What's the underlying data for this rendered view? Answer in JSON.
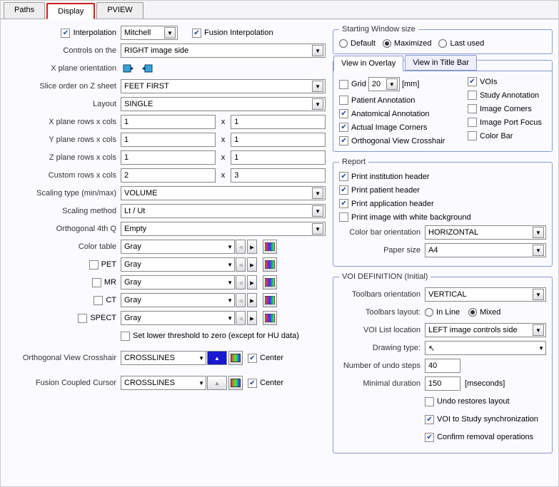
{
  "tabs": {
    "paths": "Paths",
    "display": "Display",
    "pview": "PVIEW"
  },
  "interp": {
    "label": "Interpolation",
    "value": "Mitchell",
    "fusion": "Fusion Interpolation"
  },
  "controlsOn": {
    "label": "Controls on the",
    "value": "RIGHT image side"
  },
  "xplane": {
    "label": "X plane orientation"
  },
  "sliceOrder": {
    "label": "Slice order on Z sheet",
    "value": "FEET FIRST"
  },
  "layout": {
    "label": "Layout",
    "value": "SINGLE"
  },
  "rowscols": {
    "x": {
      "label": "X plane rows x cols",
      "r": "1",
      "c": "1"
    },
    "y": {
      "label": "Y plane rows x cols",
      "r": "1",
      "c": "1"
    },
    "z": {
      "label": "Z plane rows x cols",
      "r": "1",
      "c": "1"
    },
    "custom": {
      "label": "Custom rows x cols",
      "r": "2",
      "c": "3"
    },
    "sep": "x"
  },
  "scalingType": {
    "label": "Scaling type (min/max)",
    "value": "VOLUME"
  },
  "scalingMethod": {
    "label": "Scaling method",
    "value": "Lt / Ut"
  },
  "ortho4q": {
    "label": "Orthogonal 4th Q",
    "value": "Empty"
  },
  "colorTable": {
    "label": "Color table",
    "value": "Gray"
  },
  "pet": {
    "label": "PET",
    "value": "Gray"
  },
  "mr": {
    "label": "MR",
    "value": "Gray"
  },
  "ct": {
    "label": "CT",
    "value": "Gray"
  },
  "spect": {
    "label": "SPECT",
    "value": "Gray"
  },
  "lowerThresh": "Set lower threshold to zero (except for HU data)",
  "orthoCrosshair": {
    "label": "Orthogonal View Crosshair",
    "value": "CROSSLINES",
    "center": "Center"
  },
  "fusionCursor": {
    "label": "Fusion Coupled Cursor",
    "value": "CROSSLINES",
    "center": "Center"
  },
  "startWin": {
    "legend": "Starting Window size",
    "default": "Default",
    "maximized": "Maximized",
    "lastused": "Last used"
  },
  "viewTabs": {
    "overlay": "View in Overlay",
    "titlebar": "View in Title Bar"
  },
  "overlay": {
    "grid": "Grid",
    "gridVal": "20",
    "gridUnit": "[mm]",
    "vois": "VOIs",
    "patAnn": "Patient Annotation",
    "studyAnn": "Study Annotation",
    "anatAnn": "Anatomical Annotation",
    "imgCorners": "Image Corners",
    "actCorners": "Actual Image Corners",
    "portFocus": "Image Port Focus",
    "orthoXhair": "Orthogonal View Crosshair",
    "colorBar": "Color Bar"
  },
  "report": {
    "legend": "Report",
    "inst": "Print institution header",
    "pat": "Print patient header",
    "app": "Print application header",
    "white": "Print image with white background",
    "cbOrient": {
      "label": "Color bar orientation",
      "value": "HORIZONTAL"
    },
    "paper": {
      "label": "Paper size",
      "value": "A4"
    }
  },
  "voidef": {
    "legend": "VOI DEFINITION (Initial)",
    "tbOrient": {
      "label": "Toolbars orientation",
      "value": "VERTICAL"
    },
    "tbLayout": {
      "label": "Toolbars layout:",
      "inline": "In Line",
      "mixed": "Mixed"
    },
    "listLoc": {
      "label": "VOI List location",
      "value": "LEFT image controls side"
    },
    "drawType": {
      "label": "Drawing type:",
      "value": ""
    },
    "undo": {
      "label": "Number of undo steps",
      "value": "40"
    },
    "mindur": {
      "label": "Minimal duration",
      "value": "150",
      "unit": "[mseconds]"
    },
    "restores": "Undo restores layout",
    "sync": "VOI to Study synchronization",
    "confirm": "Confirm removal operations"
  }
}
